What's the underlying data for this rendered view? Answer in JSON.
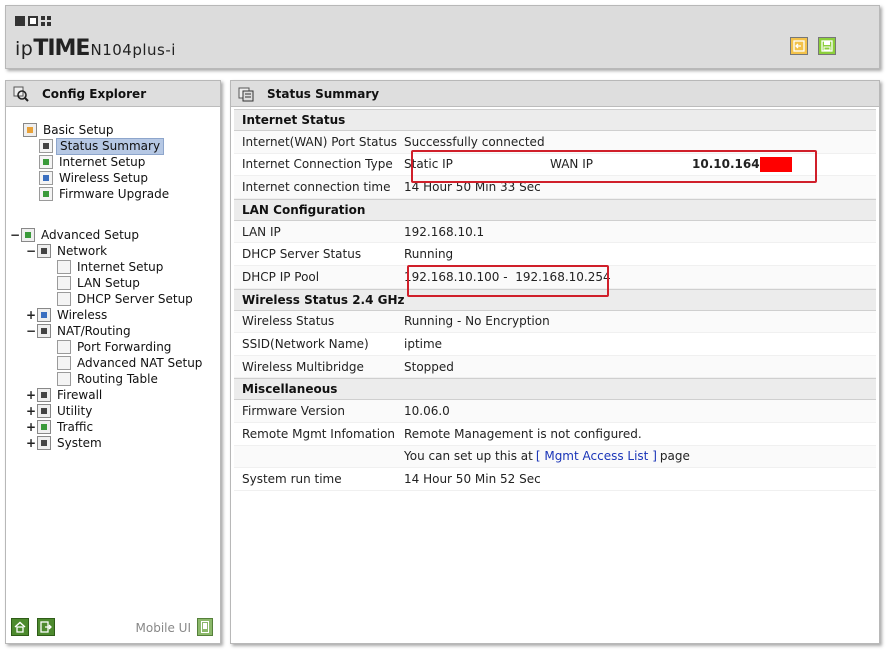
{
  "header": {
    "logo": {
      "ip": "ip",
      "time": "TIME",
      "model": "N104plus-i"
    }
  },
  "explorer": {
    "title": "Config Explorer",
    "basic_setup": {
      "label": "Basic Setup",
      "items": [
        "Status Summary",
        "Internet Setup",
        "Wireless Setup",
        "Firmware Upgrade"
      ],
      "selected": "Status Summary"
    },
    "advanced_setup": {
      "label": "Advanced Setup",
      "network": {
        "label": "Network",
        "items": [
          "Internet Setup",
          "LAN Setup",
          "DHCP Server Setup"
        ]
      },
      "wireless": "Wireless",
      "nat": {
        "label": "NAT/Routing",
        "items": [
          "Port Forwarding",
          "Advanced NAT Setup",
          "Routing Table"
        ]
      },
      "firewall": "Firewall",
      "utility": "Utility",
      "traffic": "Traffic",
      "system": "System"
    },
    "mobile_ui": "Mobile UI",
    "expander_open": "−",
    "expander_closed": "+"
  },
  "status": {
    "title": "Status Summary",
    "internet": {
      "heading": "Internet Status",
      "port_status": {
        "label": "Internet(WAN) Port Status",
        "value": "Successfully connected"
      },
      "connection_type": {
        "label": "Internet Connection Type",
        "value": "Static IP",
        "wan_label": "WAN IP",
        "wan_ip": "10.10.164."
      },
      "connection_time": {
        "label": "Internet connection time",
        "value": "14 Hour 50 Min 33 Sec"
      }
    },
    "lan": {
      "heading": "LAN Configuration",
      "lan_ip": {
        "label": "LAN IP",
        "value": "192.168.10.1"
      },
      "dhcp_status": {
        "label": "DHCP Server Status",
        "value": "Running"
      },
      "dhcp_pool": {
        "label": "DHCP IP Pool",
        "value": "192.168.10.100 -  192.168.10.254"
      }
    },
    "wireless": {
      "heading": "Wireless Status 2.4 GHz",
      "status": {
        "label": "Wireless Status",
        "value": "Running - No Encryption"
      },
      "ssid": {
        "label": "SSID(Network Name)",
        "value": "iptime"
      },
      "multibridge": {
        "label": "Wireless Multibridge",
        "value": "Stopped"
      }
    },
    "misc": {
      "heading": "Miscellaneous",
      "firmware": {
        "label": "Firmware Version",
        "value": "10.06.0"
      },
      "remote": {
        "label": "Remote Mgmt Infomation",
        "value": "Remote Management is not configured.",
        "setup_prefix": "You can set up this at",
        "setup_link": "[ Mgmt Access List ]",
        "setup_suffix": "page"
      },
      "run_time": {
        "label": "System run time",
        "value": "14 Hour 50 Min 52 Sec"
      }
    }
  },
  "colors": {
    "highlight": "#d01f2a",
    "selected": "#b6c8e4",
    "link": "#1a35b8"
  }
}
